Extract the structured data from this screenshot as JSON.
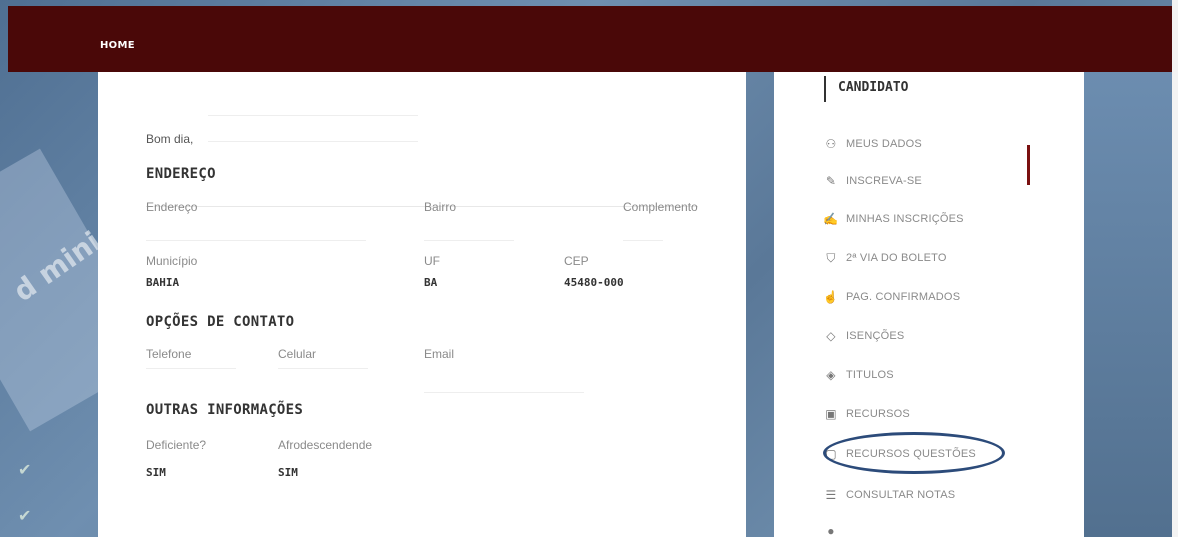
{
  "topbar": {
    "home_label": "HOME"
  },
  "background": {
    "device_text": "d mini"
  },
  "main": {
    "greeting": "Bom dia,",
    "sections": {
      "endereco": {
        "title": "ENDEREÇO",
        "labels": {
          "endereco": "Endereço",
          "bairro": "Bairro",
          "complemento": "Complemento",
          "municipio": "Município",
          "uf": "UF",
          "cep": "CEP"
        },
        "values": {
          "municipio": "BAHIA",
          "uf": "BA",
          "cep": "45480-000"
        }
      },
      "contato": {
        "title": "OPÇÕES DE CONTATO",
        "labels": {
          "telefone": "Telefone",
          "celular": "Celular",
          "email": "Email"
        }
      },
      "outras": {
        "title": "OUTRAS INFORMAÇÕES",
        "labels": {
          "deficiente": "Deficiente?",
          "afro": "Afrodescendende"
        },
        "values": {
          "deficiente": "SIM",
          "afro": "SIM"
        }
      }
    }
  },
  "sidebar": {
    "title": "CANDIDATO",
    "items": [
      {
        "label": "MEUS DADOS",
        "icon": "user-icon"
      },
      {
        "label": "INSCREVA-SE",
        "icon": "pencil-icon"
      },
      {
        "label": "MINHAS INSCRIÇÕES",
        "icon": "edit-icon"
      },
      {
        "label": "2ª VIA DO BOLETO",
        "icon": "cart-icon"
      },
      {
        "label": "PAG. CONFIRMADOS",
        "icon": "thumbs-up-icon"
      },
      {
        "label": "ISENÇÕES",
        "icon": "tag-icon"
      },
      {
        "label": "TITULOS",
        "icon": "graduation-cap-icon"
      },
      {
        "label": "RECURSOS",
        "icon": "clipboard-icon"
      },
      {
        "label": "RECURSOS QUESTÕES",
        "icon": "file-icon"
      },
      {
        "label": "CONSULTAR NOTAS",
        "icon": "list-icon"
      }
    ]
  },
  "colors": {
    "topbar": "#4a0808",
    "accent": "#7a1010",
    "highlight_circle": "#2c4b7a"
  }
}
